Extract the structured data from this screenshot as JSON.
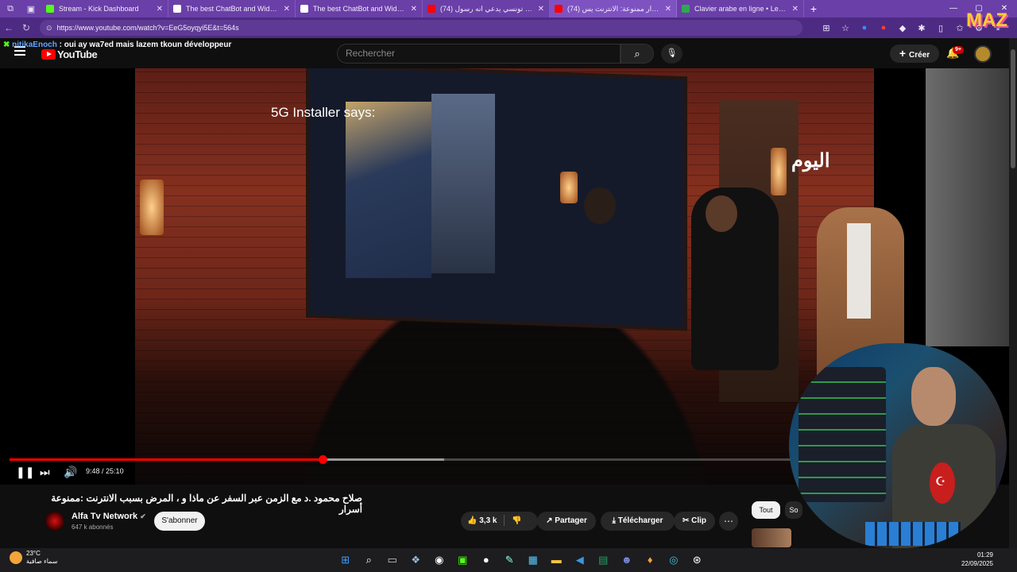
{
  "browser": {
    "tabs": [
      {
        "title": "Stream - Kick Dashboard",
        "color": "#53fc18",
        "active": false
      },
      {
        "title": "The best ChatBot and Widgets fo",
        "color": "#ffffff",
        "active": false
      },
      {
        "title": "The best ChatBot and Widgets fo",
        "color": "#ffffff",
        "active": false
      },
      {
        "title": "(74) تونسي يدعي انه رسول - YouTube",
        "color": "#ff0000",
        "active": false
      },
      {
        "title": "(74) أسرار ممنوعة: الانترنت يس",
        "color": "#ff0000",
        "active": true
      },
      {
        "title": "Clavier arabe en ligne • Lexilogos",
        "color": "#2fa84f",
        "active": false
      }
    ],
    "url": "https://www.youtube.com/watch?v=EeG5oyqyi5E&t=564s"
  },
  "chat_overlay": {
    "user": "nitikaEnoch",
    "message": ": oui ay wa7ed mais lazem tkoun développeur"
  },
  "youtube": {
    "logo_text": "YouTube",
    "search_placeholder": "Rechercher",
    "create_label": "Créer",
    "notif_count": "9+"
  },
  "video": {
    "overlay_text": "5G Installer says:",
    "channel_bug": "اليوم",
    "current_time": "9:48",
    "duration": "25:10",
    "progress": 0.4,
    "buffered": 0.555,
    "title": "صلاح محمود .د مع الزمن عبر السفر عن ماذا و ، المرض بسبب الانترنت :ممنوعة أسرار"
  },
  "channel": {
    "name": "Alfa Tv Network",
    "verified_icon": "verified-check-icon",
    "subscribers": "647 k abonnés",
    "subscribe_label": "S'abonner"
  },
  "actions": {
    "likes": "3,3 k",
    "share": "Partager",
    "download": "Télécharger",
    "clip": "Clip"
  },
  "chips": {
    "all": "Tout",
    "second": "So"
  },
  "taskbar": {
    "temperature": "23°C",
    "weather_text": "سماء صافية",
    "time": "01:29",
    "date": "22/09/2025"
  },
  "stream_logo": "MAZ",
  "colors": {
    "browser_frame": "#6a3fa8",
    "progress_red": "#ff0000",
    "background": "#0f0f0f"
  }
}
